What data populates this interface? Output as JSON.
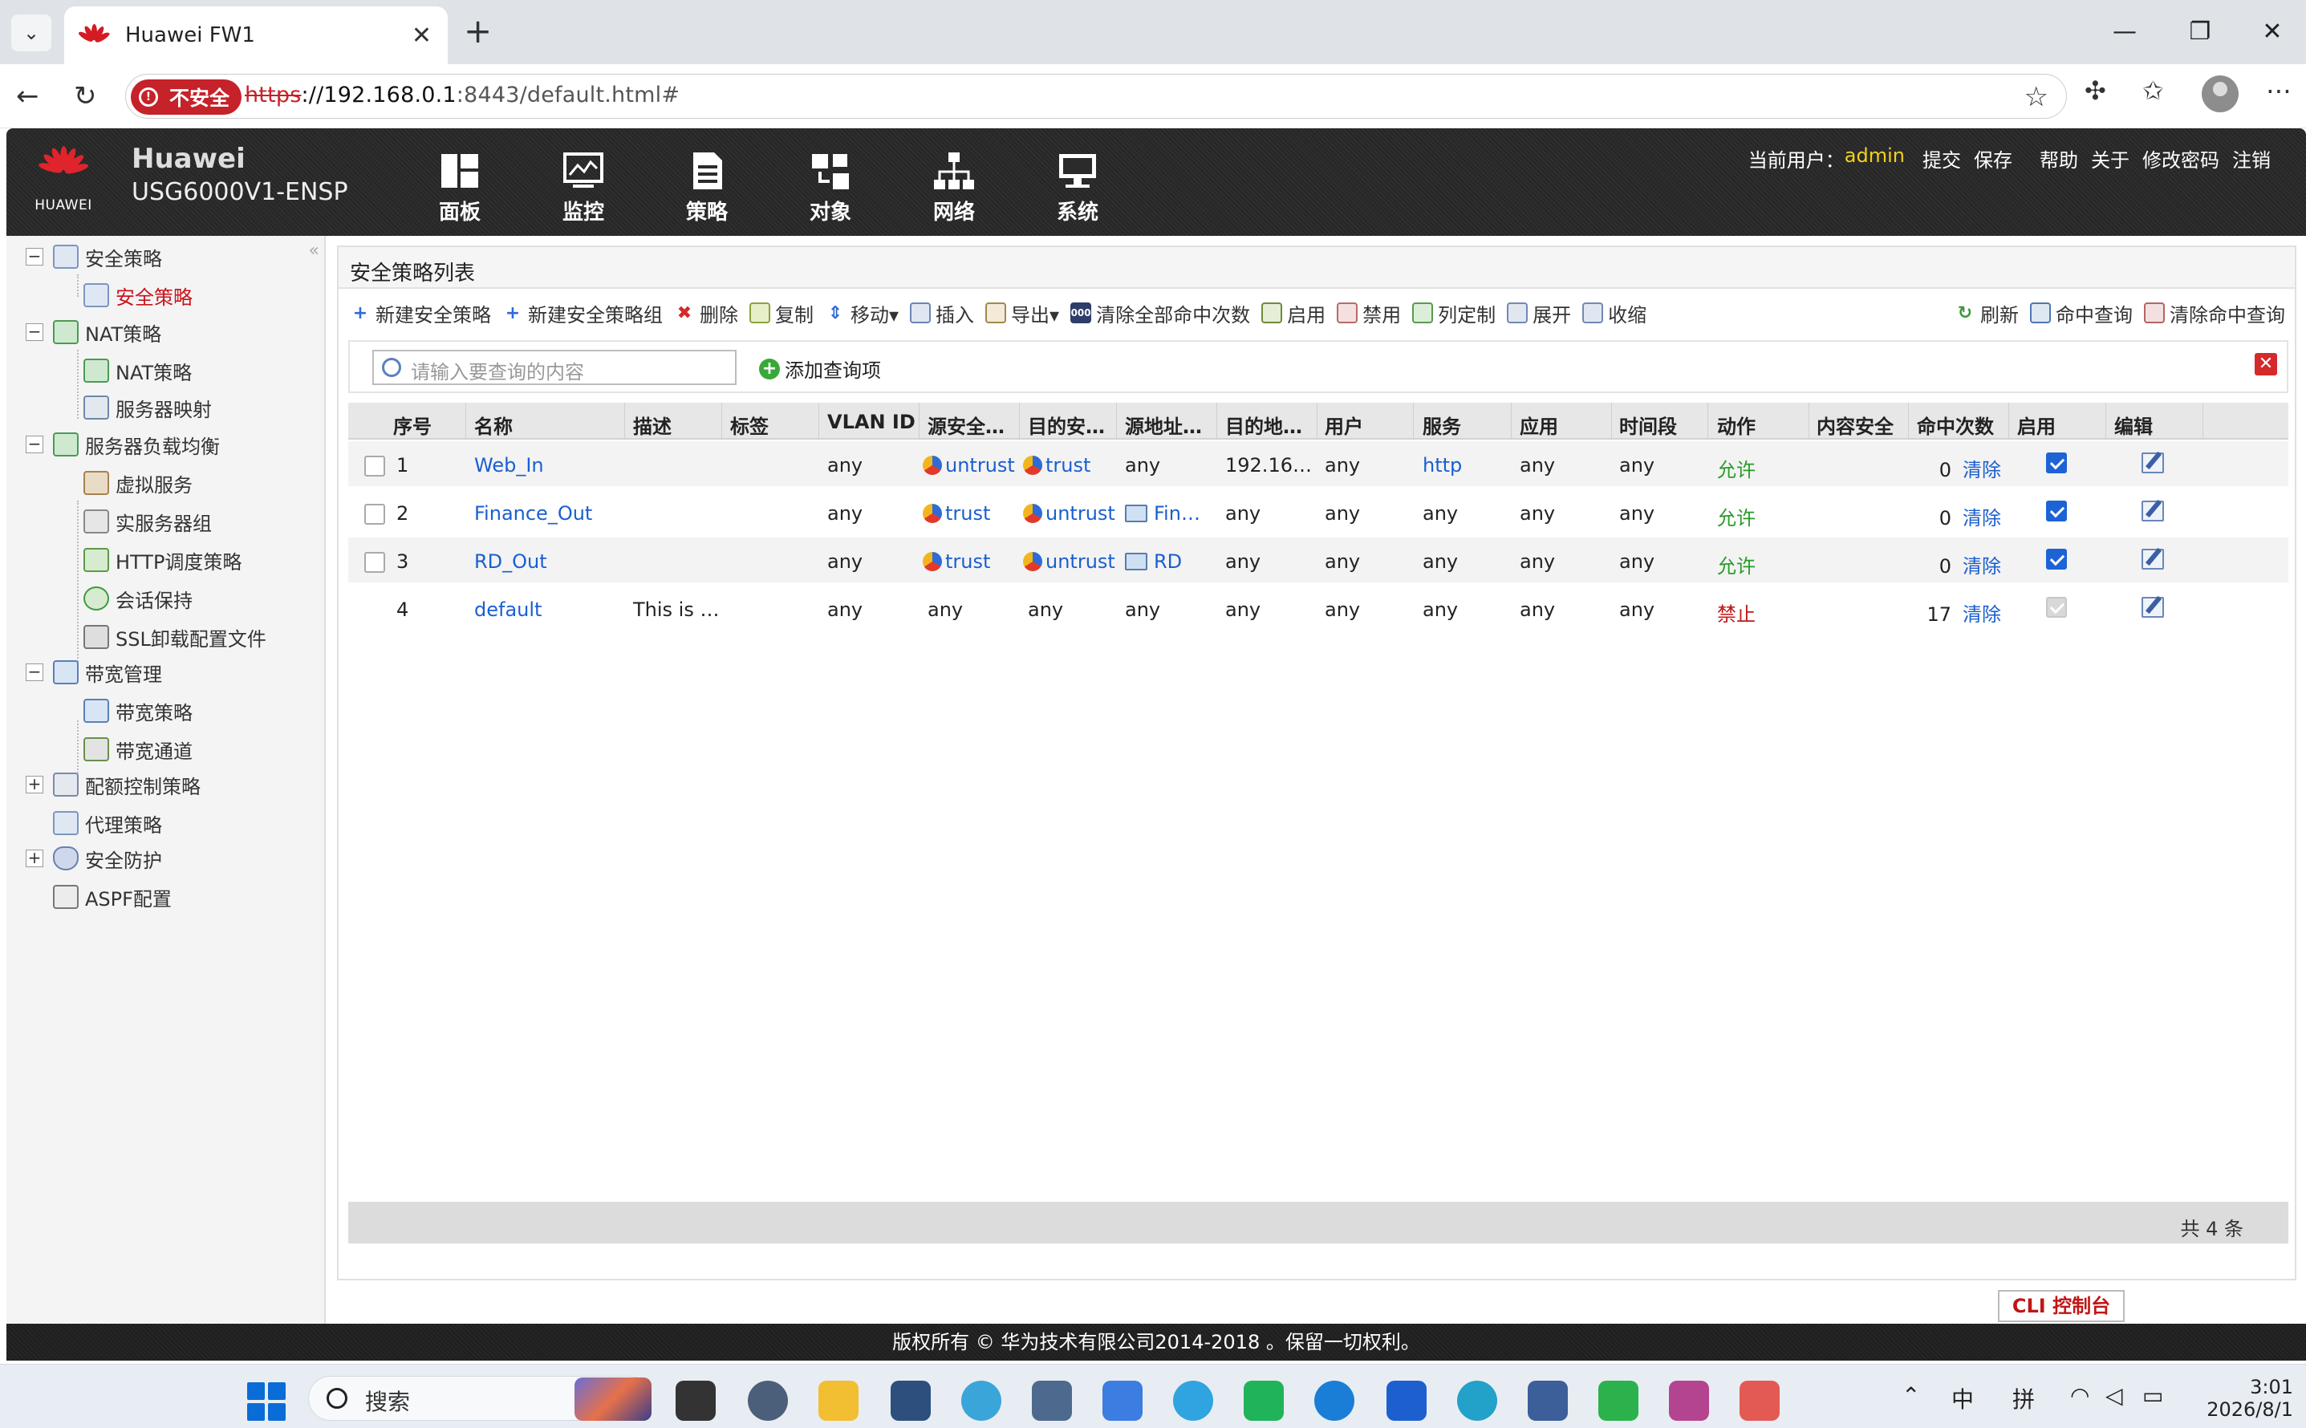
{
  "browser": {
    "tab_title": "Huawei FW1",
    "insecure_label": "不安全",
    "url_scheme": "https",
    "url_host": "://192.168.0.1",
    "url_rest": ":8443/default.html#"
  },
  "header": {
    "brand_logo_text": "HUAWEI",
    "brand_line1": "Huawei",
    "brand_line2": "USG6000V1-ENSP",
    "nav": [
      {
        "label": "面板",
        "icon": "dashboard-icon"
      },
      {
        "label": "监控",
        "icon": "monitor-icon"
      },
      {
        "label": "策略",
        "icon": "policy-icon"
      },
      {
        "label": "对象",
        "icon": "object-icon"
      },
      {
        "label": "网络",
        "icon": "network-icon"
      },
      {
        "label": "系统",
        "icon": "system-icon"
      }
    ],
    "current_user_label": "当前用户：",
    "current_user": "admin",
    "actions": [
      "提交",
      "保存",
      "帮助",
      "关于",
      "修改密码",
      "注销"
    ]
  },
  "sidebar": {
    "items": [
      {
        "label": "安全策略",
        "level": 0,
        "toggle": "−"
      },
      {
        "label": "安全策略",
        "level": 1,
        "active": true
      },
      {
        "label": "NAT策略",
        "level": 0,
        "toggle": "−"
      },
      {
        "label": "NAT策略",
        "level": 1
      },
      {
        "label": "服务器映射",
        "level": 1
      },
      {
        "label": "服务器负载均衡",
        "level": 0,
        "toggle": "−"
      },
      {
        "label": "虚拟服务",
        "level": 1
      },
      {
        "label": "实服务器组",
        "level": 1
      },
      {
        "label": "HTTP调度策略",
        "level": 1
      },
      {
        "label": "会话保持",
        "level": 1
      },
      {
        "label": "SSL卸载配置文件",
        "level": 1
      },
      {
        "label": "带宽管理",
        "level": 0,
        "toggle": "−"
      },
      {
        "label": "带宽策略",
        "level": 1
      },
      {
        "label": "带宽通道",
        "level": 1
      },
      {
        "label": "配额控制策略",
        "level": 0,
        "toggle": "+"
      },
      {
        "label": "代理策略",
        "level": 0
      },
      {
        "label": "安全防护",
        "level": 0,
        "toggle": "+"
      },
      {
        "label": "ASPF配置",
        "level": 0
      }
    ]
  },
  "panel": {
    "title": "安全策略列表",
    "toolbar_left": [
      "新建安全策略",
      "新建安全策略组",
      "删除",
      "复制",
      "移动▾",
      "插入",
      "导出▾",
      "清除全部命中次数",
      "启用",
      "禁用",
      "列定制",
      "展开",
      "收缩"
    ],
    "toolbar_right": [
      "刷新",
      "命中查询",
      "清除命中查询"
    ],
    "search_placeholder": "请输入要查询的内容",
    "add_query": "添加查询项",
    "columns": [
      "序号",
      "名称",
      "描述",
      "标签",
      "VLAN ID",
      "源安全…",
      "目的安…",
      "源地址…",
      "目的地…",
      "用户",
      "服务",
      "应用",
      "时间段",
      "动作",
      "内容安全",
      "命中次数",
      "启用",
      "编辑"
    ],
    "rows": [
      {
        "no": "1",
        "name": "Web_In",
        "desc": "",
        "tag": "",
        "vlan": "any",
        "src_zone": "untrust",
        "dst_zone": "trust",
        "src_addr": "any",
        "dst_addr": "192.16…",
        "user": "any",
        "service": "http",
        "app": "any",
        "time": "any",
        "action": "允许",
        "content": "",
        "hits": "0",
        "clear": "清除",
        "enabled": true
      },
      {
        "no": "2",
        "name": "Finance_Out",
        "desc": "",
        "tag": "",
        "vlan": "any",
        "src_zone": "trust",
        "dst_zone": "untrust",
        "src_addr": "Fin…",
        "dst_addr": "any",
        "user": "any",
        "service": "any",
        "app": "any",
        "time": "any",
        "action": "允许",
        "content": "",
        "hits": "0",
        "clear": "清除",
        "enabled": true
      },
      {
        "no": "3",
        "name": "RD_Out",
        "desc": "",
        "tag": "",
        "vlan": "any",
        "src_zone": "trust",
        "dst_zone": "untrust",
        "src_addr": "RD",
        "dst_addr": "any",
        "user": "any",
        "service": "any",
        "app": "any",
        "time": "any",
        "action": "允许",
        "content": "",
        "hits": "0",
        "clear": "清除",
        "enabled": true
      },
      {
        "no": "4",
        "name": "default",
        "desc": "This is …",
        "tag": "",
        "vlan": "any",
        "src_zone": "any",
        "dst_zone": "any",
        "src_addr": "any",
        "dst_addr": "any",
        "user": "any",
        "service": "any",
        "app": "any",
        "time": "any",
        "action": "禁止",
        "content": "",
        "hits": "17",
        "clear": "清除",
        "enabled": false
      }
    ],
    "total": "共 4 条"
  },
  "cli_button": "CLI 控制台",
  "footer": "版权所有 © 华为技术有限公司2014-2018 。保留一切权利。",
  "taskbar": {
    "search_label": "搜索",
    "ime1": "中",
    "ime2": "拼",
    "time": "3:01",
    "date": "2026/8/1"
  }
}
